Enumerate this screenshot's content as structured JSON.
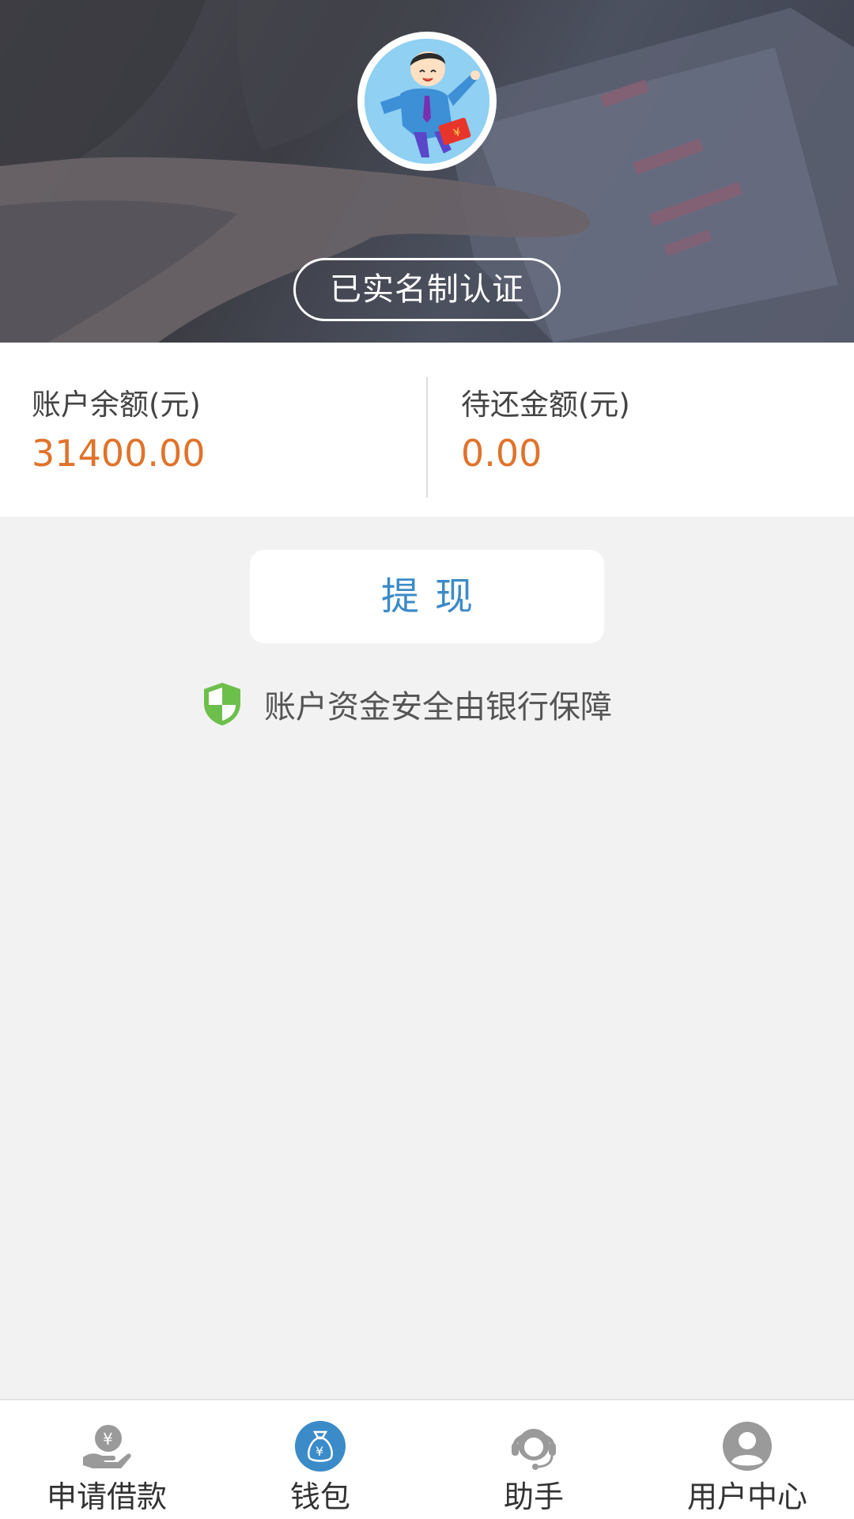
{
  "header": {
    "verified_label": "已实名制认证"
  },
  "account": {
    "balance_label": "账户余额(元)",
    "balance_value": "31400.00",
    "due_label": "待还金额(元)",
    "due_value": "0.00"
  },
  "actions": {
    "withdraw_label": "提现",
    "security_note": "账户资金安全由银行保障"
  },
  "tabbar": {
    "items": [
      {
        "label": "申请借款",
        "icon": "hand-yen-icon",
        "active": false
      },
      {
        "label": "钱包",
        "icon": "money-bag-icon",
        "active": true
      },
      {
        "label": "助手",
        "icon": "headset-icon",
        "active": false
      },
      {
        "label": "用户中心",
        "icon": "user-icon",
        "active": false
      }
    ]
  },
  "colors": {
    "accent_blue": "#3b8bc9",
    "amount_orange": "#e0732b",
    "shield_green": "#6cbf4b",
    "tab_icon_gray": "#9a9a9a"
  }
}
